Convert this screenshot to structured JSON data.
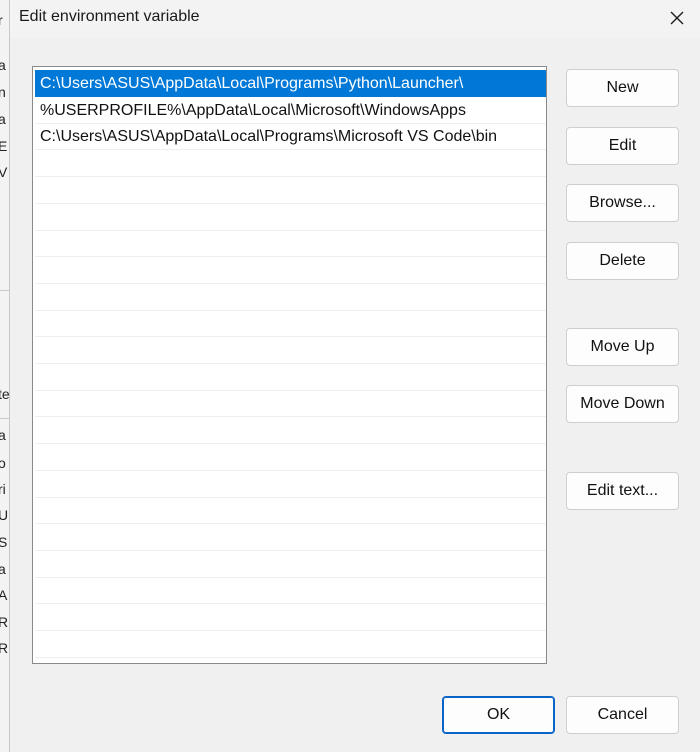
{
  "window": {
    "title": "Edit environment variable"
  },
  "background_glyphs": [
    "r",
    "a",
    "n",
    "a",
    "E",
    "V",
    "te",
    "a",
    "o",
    "ri",
    "U",
    "S",
    "a",
    "A",
    "R",
    "R"
  ],
  "paths": [
    "C:\\Users\\ASUS\\AppData\\Local\\Programs\\Python\\Launcher\\",
    "%USERPROFILE%\\AppData\\Local\\Microsoft\\WindowsApps",
    "C:\\Users\\ASUS\\AppData\\Local\\Programs\\Microsoft VS Code\\bin"
  ],
  "selected_index": 0,
  "buttons": {
    "new": "New",
    "edit": "Edit",
    "browse": "Browse...",
    "delete": "Delete",
    "move_up": "Move Up",
    "move_down": "Move Down",
    "edit_text": "Edit text...",
    "ok": "OK",
    "cancel": "Cancel"
  },
  "colors": {
    "selection": "#0078d7",
    "default_button_border": "#0a64c8"
  }
}
